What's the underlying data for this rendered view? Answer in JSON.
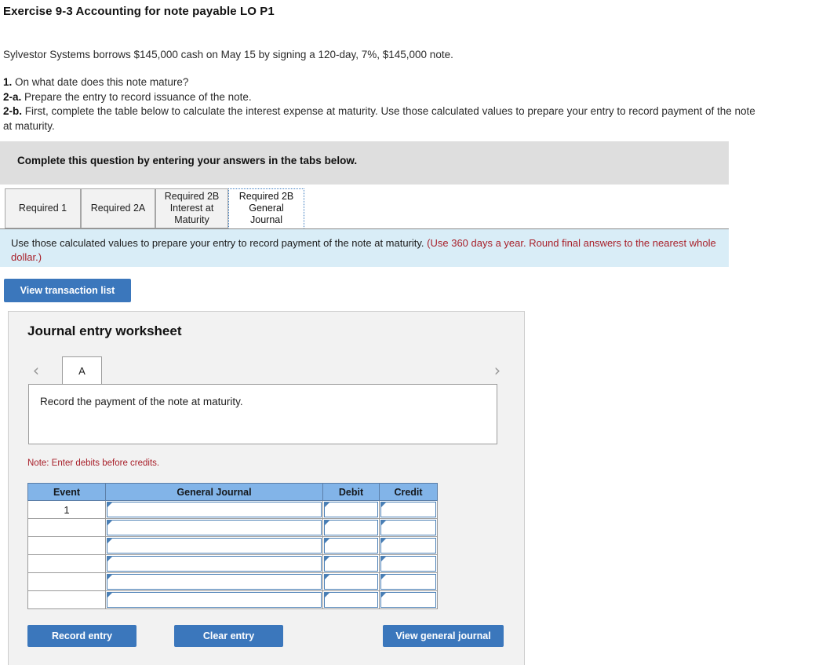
{
  "exercise": {
    "title": "Exercise 9-3 Accounting for note payable LO P1",
    "problem_statement": "Sylvestor Systems borrows $145,000 cash on May 15 by signing a 120-day, 7%, $145,000 note.",
    "requirements": [
      {
        "num": "1.",
        "text": " On what date does this note mature?"
      },
      {
        "num": "2-a.",
        "text": " Prepare the entry to record issuance of the note."
      },
      {
        "num": "2-b.",
        "text": " First, complete the table below to calculate the interest expense at maturity. Use those calculated values to prepare your entry to record payment of the note at maturity."
      }
    ]
  },
  "banner": {
    "instruction": "Complete this question by entering your answers in the tabs below."
  },
  "tabs": [
    {
      "label": "Required 1",
      "active": false
    },
    {
      "label": "Required 2A",
      "active": false
    },
    {
      "label": "Required 2B Interest at Maturity",
      "active": false
    },
    {
      "label": "Required 2B General Journal",
      "active": true
    }
  ],
  "info_bar": {
    "text": "Use those calculated values to prepare your entry to record payment of the note at maturity. ",
    "note": "(Use 360 days a year. Round final answers to the nearest whole dollar.)"
  },
  "toolbar": {
    "view_transaction_list_label": "View transaction list"
  },
  "worksheet": {
    "title": "Journal entry worksheet",
    "letter_tab": "A",
    "prev_icon": "chevron-left-icon",
    "next_icon": "chevron-right-icon",
    "description": "Record the payment of the note at maturity.",
    "debit_note": "Note: Enter debits before credits.",
    "table": {
      "headers": [
        "Event",
        "General Journal",
        "Debit",
        "Credit"
      ],
      "rows": [
        {
          "event": "1",
          "journal": "",
          "debit": "",
          "credit": ""
        },
        {
          "event": "",
          "journal": "",
          "debit": "",
          "credit": ""
        },
        {
          "event": "",
          "journal": "",
          "debit": "",
          "credit": ""
        },
        {
          "event": "",
          "journal": "",
          "debit": "",
          "credit": ""
        },
        {
          "event": "",
          "journal": "",
          "debit": "",
          "credit": ""
        },
        {
          "event": "",
          "journal": "",
          "debit": "",
          "credit": ""
        }
      ]
    },
    "buttons": {
      "record_entry": "Record entry",
      "clear_entry": "Clear entry",
      "view_general_journal": "View general journal"
    }
  },
  "colors": {
    "button_blue": "#3b77bc",
    "table_header_blue": "#82b4e8",
    "info_bar_blue": "#d9edf7",
    "banner_gray": "#dedede",
    "note_red": "#a8202a",
    "panel_gray": "#f2f2f2"
  }
}
